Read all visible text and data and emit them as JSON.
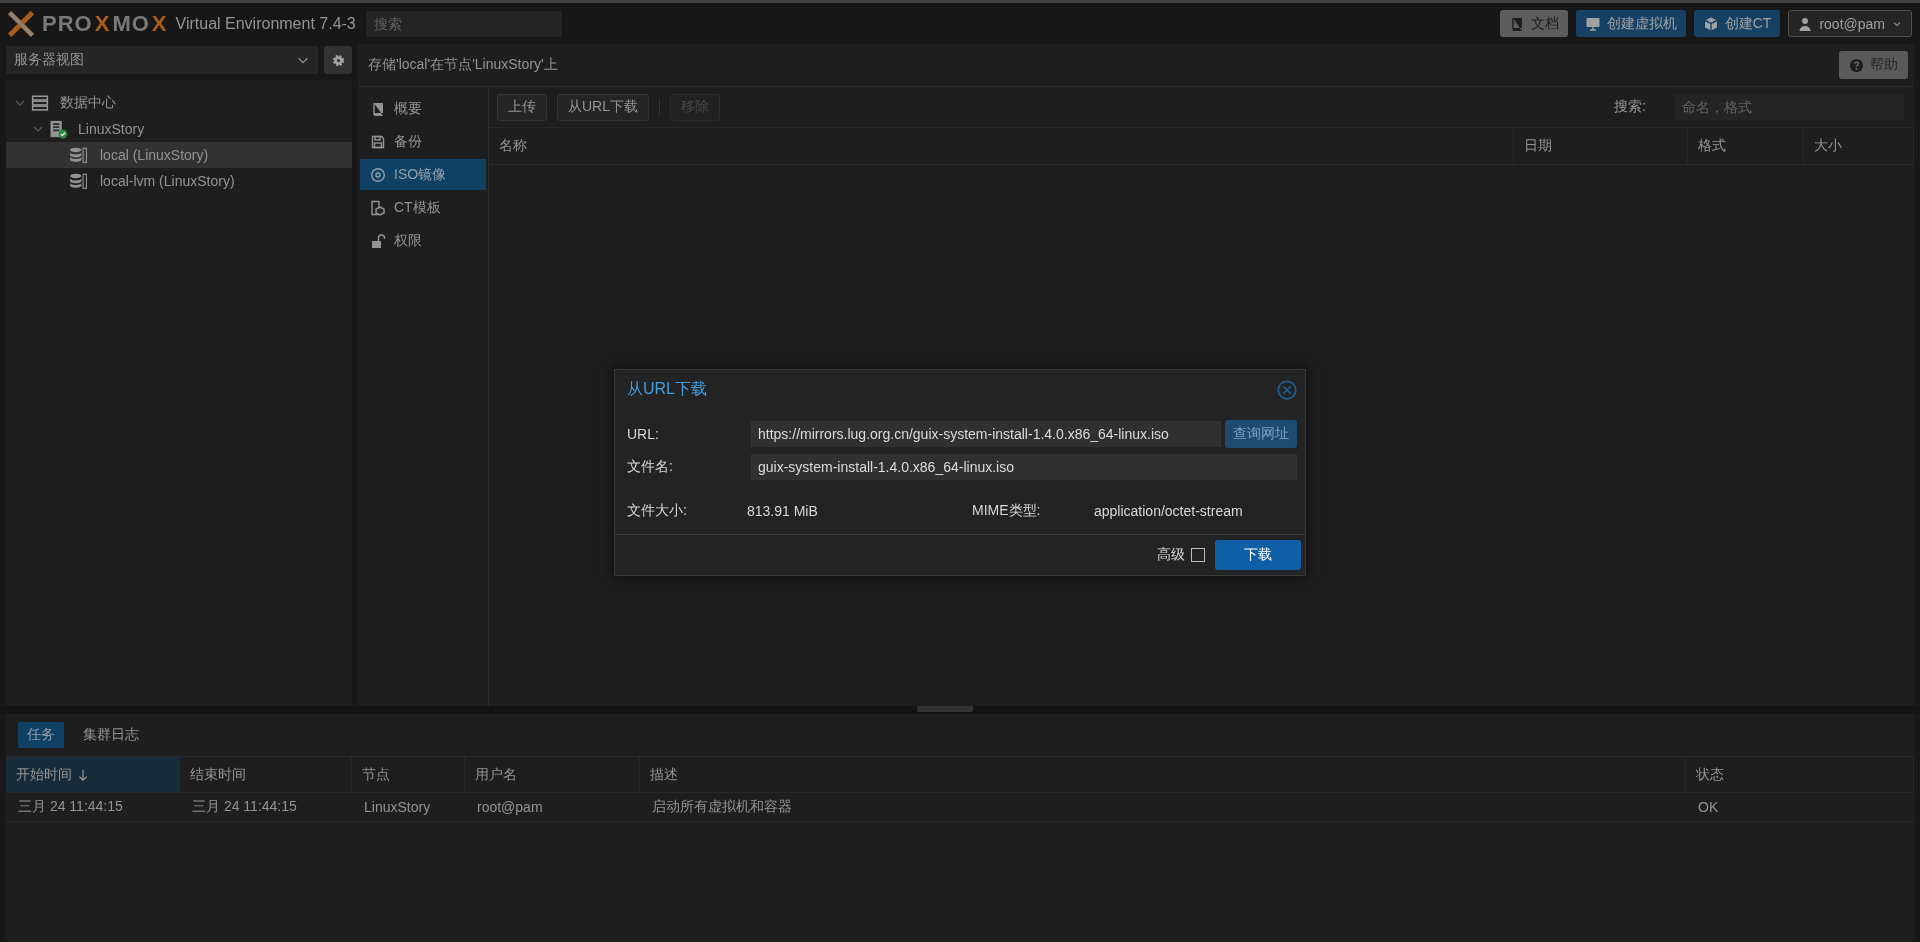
{
  "header": {
    "logo": [
      {
        "text": "PRO",
        "accent": false
      },
      {
        "text": "X",
        "accent": true
      },
      {
        "text": "MO",
        "accent": false
      },
      {
        "text": "X",
        "accent": true
      }
    ],
    "version": "Virtual Environment 7.4-3",
    "search": {
      "placeholder": "搜索"
    },
    "buttons": [
      {
        "label": "文档",
        "kind": "docs"
      },
      {
        "label": "创建虚拟机",
        "kind": "vm"
      },
      {
        "label": "创建CT",
        "kind": "ct"
      },
      {
        "label": "root@pam",
        "kind": "user"
      }
    ]
  },
  "sidebar": {
    "view_selector": "服务器视图",
    "tree": [
      {
        "label": "数据中心",
        "kind": "datacenter",
        "expanded": true,
        "selected": false,
        "children": [
          {
            "label": "LinuxStory",
            "kind": "node",
            "expanded": true,
            "selected": false,
            "children": [
              {
                "label": "local (LinuxStory)",
                "kind": "storage",
                "selected": true
              },
              {
                "label": "local-lvm (LinuxStory)",
                "kind": "storage",
                "selected": false
              }
            ]
          }
        ]
      }
    ]
  },
  "content": {
    "title": "存储'local'在节点'LinuxStory'上",
    "help_button": "帮助",
    "nav": [
      {
        "label": "概要",
        "kind": "summary",
        "selected": false
      },
      {
        "label": "备份",
        "kind": "backup",
        "selected": false
      },
      {
        "label": "ISO镜像",
        "kind": "iso",
        "selected": true
      },
      {
        "label": "CT模板",
        "kind": "template",
        "selected": false
      },
      {
        "label": "权限",
        "kind": "permissions",
        "selected": false
      }
    ],
    "toolbar": [
      {
        "label": "上传",
        "disabled": false
      },
      {
        "label": "从URL下载",
        "disabled": false
      },
      {
        "label": "移除",
        "disabled": true
      }
    ],
    "search_label": "搜索:",
    "search": {
      "placeholder": "命名，格式"
    },
    "table": {
      "columns": [
        "名称",
        "日期",
        "格式",
        "大小"
      ]
    }
  },
  "bottom_panel": {
    "tabs": [
      {
        "label": "任务",
        "selected": true
      },
      {
        "label": "集群日志",
        "selected": false
      }
    ],
    "table": {
      "columns": [
        {
          "label": "开始时间",
          "sorted": true
        },
        {
          "label": "结束时间",
          "sorted": false
        },
        {
          "label": "节点",
          "sorted": false
        },
        {
          "label": "用户名",
          "sorted": false
        },
        {
          "label": "描述",
          "sorted": false
        },
        {
          "label": "状态",
          "sorted": false
        }
      ],
      "rows": [
        [
          "三月 24 11:44:15",
          "三月 24 11:44:15",
          "LinuxStory",
          "root@pam",
          "启动所有虚拟机和容器",
          "OK"
        ]
      ]
    }
  },
  "dialog": {
    "title": "从URL下载",
    "fields": [
      {
        "label": "URL:",
        "value": "https://mirrors.lug.org.cn/guix-system-install-1.4.0.x86_64-linux.iso",
        "button": "查询网址"
      },
      {
        "label": "文件名:",
        "value": "guix-system-install-1.4.0.x86_64-linux.iso"
      }
    ],
    "info": [
      {
        "label": "文件大小:",
        "value": "813.91 MiB"
      },
      {
        "label": "MIME类型:",
        "value": "application/octet-stream"
      }
    ],
    "advanced": {
      "label": "高级",
      "checked": false
    },
    "submit": "下载"
  }
}
